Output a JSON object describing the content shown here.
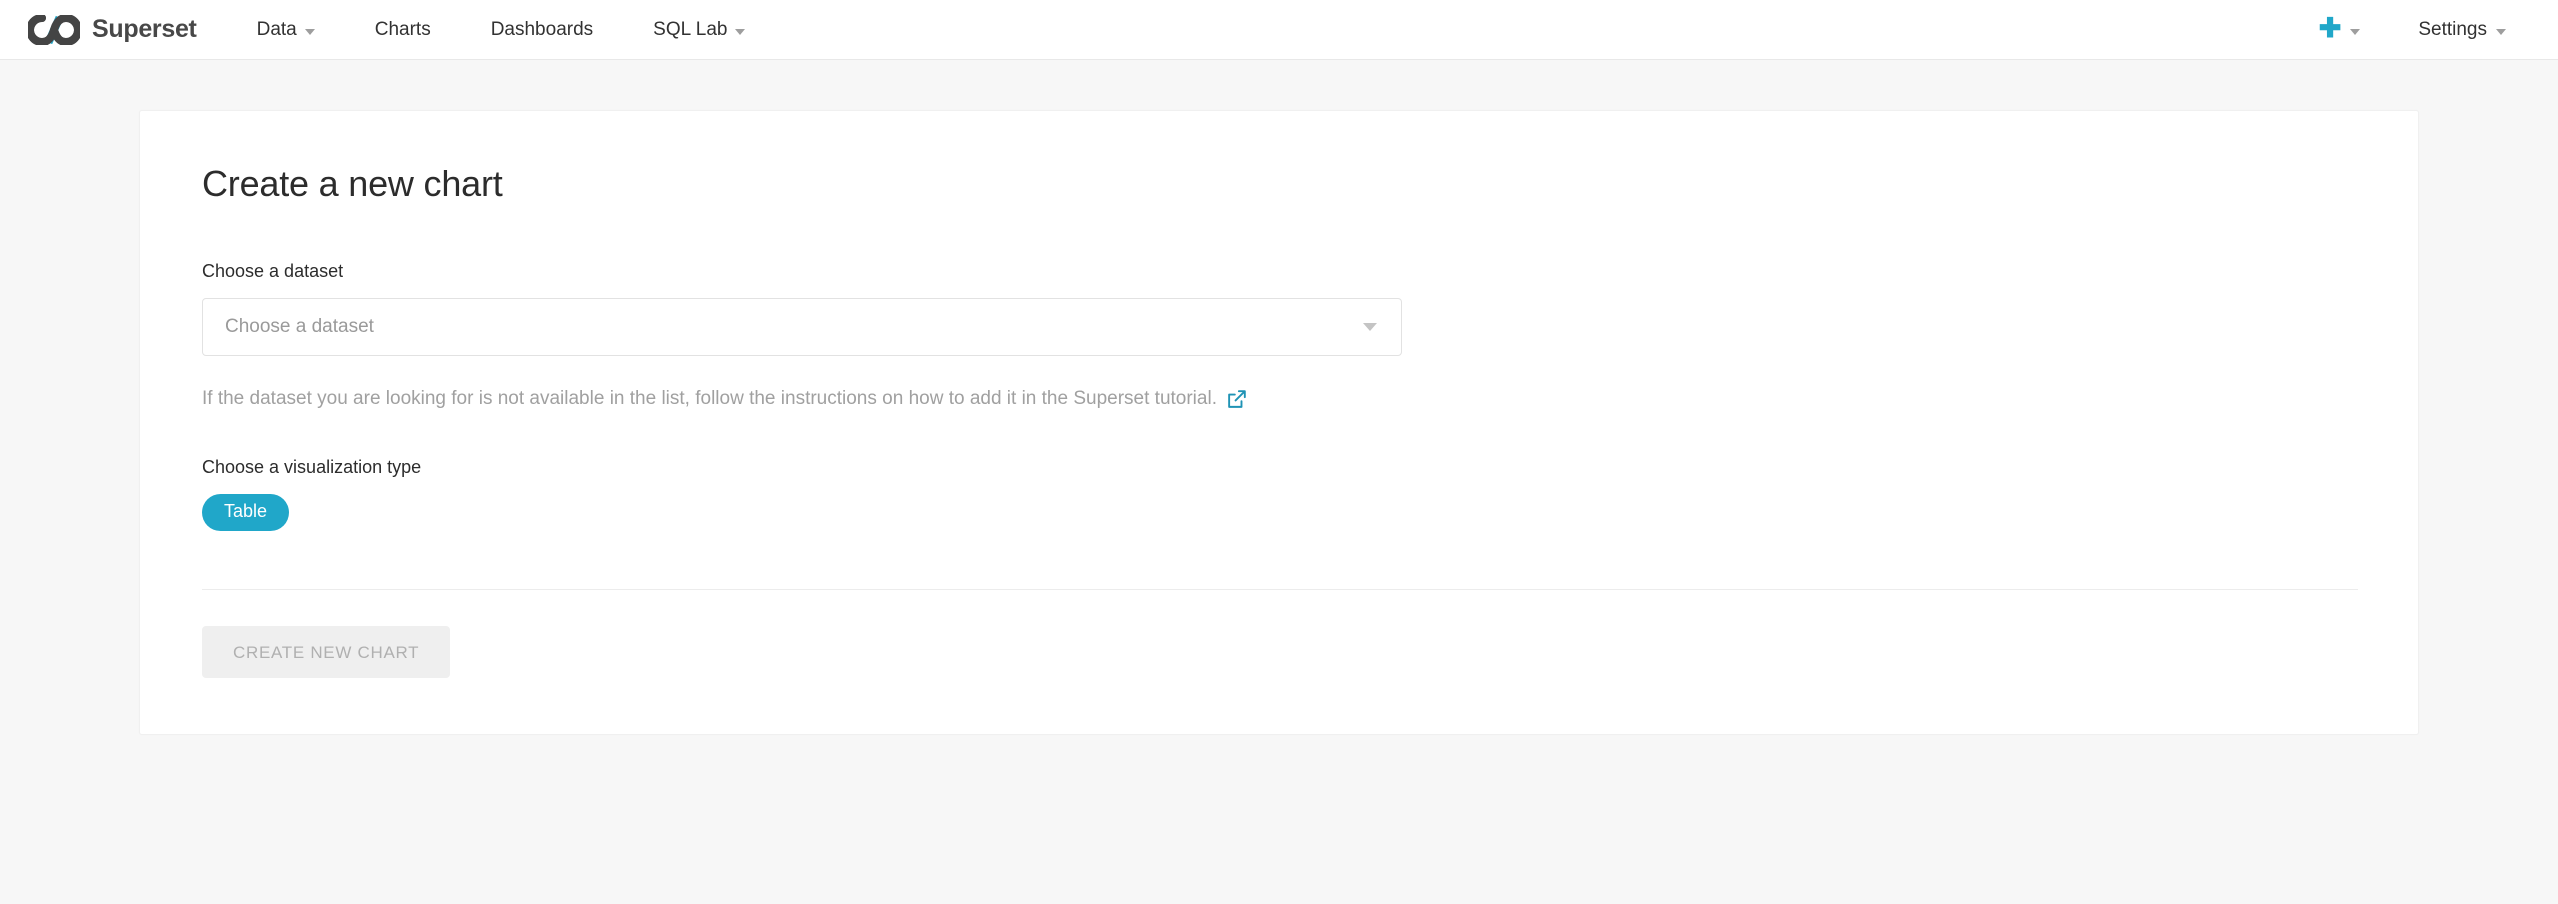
{
  "navbar": {
    "brand": {
      "name": "Superset",
      "logo_icon": "superset-infinity-logo",
      "logo_colors": {
        "loop": "#444444",
        "accent": "#20a7c9"
      }
    },
    "items": [
      {
        "label": "Data",
        "has_caret": true
      },
      {
        "label": "Charts",
        "has_caret": false
      },
      {
        "label": "Dashboards",
        "has_caret": false
      },
      {
        "label": "SQL Lab",
        "has_caret": true
      }
    ],
    "right": {
      "plus": {
        "icon": "plus-icon",
        "glyph": "✚",
        "color": "#20a7c9",
        "has_caret": true
      },
      "settings": {
        "label": "Settings",
        "has_caret": true
      }
    }
  },
  "main": {
    "title": "Create a new chart",
    "dataset": {
      "label": "Choose a dataset",
      "placeholder": "Choose a dataset",
      "value": "",
      "caret_icon": "chevron-down-icon"
    },
    "helper": {
      "text": "If the dataset you are looking for is not available in the list, follow the instructions on how to add it in the Superset tutorial.",
      "link_icon": "external-link-icon",
      "link_color": "#1f93b5"
    },
    "visualization": {
      "label": "Choose a visualization type",
      "options": [
        {
          "label": "Table",
          "selected": true,
          "color": "#20a7c9"
        }
      ]
    },
    "submit": {
      "label": "CREATE NEW CHART",
      "disabled": true
    }
  },
  "theme": {
    "page_background": "#f7f7f7",
    "card_background": "#ffffff",
    "accent": "#20a7c9",
    "text_primary": "#2c2c2c",
    "text_muted": "#a0a0a0"
  }
}
